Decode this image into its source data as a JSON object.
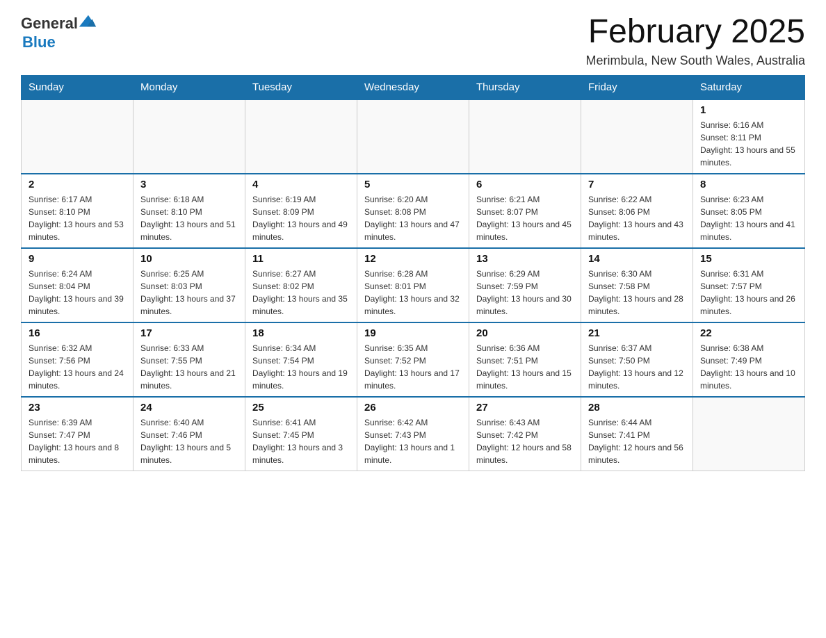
{
  "logo": {
    "general": "General",
    "blue": "Blue"
  },
  "header": {
    "title": "February 2025",
    "subtitle": "Merimbula, New South Wales, Australia"
  },
  "days_of_week": [
    "Sunday",
    "Monday",
    "Tuesday",
    "Wednesday",
    "Thursday",
    "Friday",
    "Saturday"
  ],
  "weeks": [
    [
      {
        "day": "",
        "info": ""
      },
      {
        "day": "",
        "info": ""
      },
      {
        "day": "",
        "info": ""
      },
      {
        "day": "",
        "info": ""
      },
      {
        "day": "",
        "info": ""
      },
      {
        "day": "",
        "info": ""
      },
      {
        "day": "1",
        "info": "Sunrise: 6:16 AM\nSunset: 8:11 PM\nDaylight: 13 hours and 55 minutes."
      }
    ],
    [
      {
        "day": "2",
        "info": "Sunrise: 6:17 AM\nSunset: 8:10 PM\nDaylight: 13 hours and 53 minutes."
      },
      {
        "day": "3",
        "info": "Sunrise: 6:18 AM\nSunset: 8:10 PM\nDaylight: 13 hours and 51 minutes."
      },
      {
        "day": "4",
        "info": "Sunrise: 6:19 AM\nSunset: 8:09 PM\nDaylight: 13 hours and 49 minutes."
      },
      {
        "day": "5",
        "info": "Sunrise: 6:20 AM\nSunset: 8:08 PM\nDaylight: 13 hours and 47 minutes."
      },
      {
        "day": "6",
        "info": "Sunrise: 6:21 AM\nSunset: 8:07 PM\nDaylight: 13 hours and 45 minutes."
      },
      {
        "day": "7",
        "info": "Sunrise: 6:22 AM\nSunset: 8:06 PM\nDaylight: 13 hours and 43 minutes."
      },
      {
        "day": "8",
        "info": "Sunrise: 6:23 AM\nSunset: 8:05 PM\nDaylight: 13 hours and 41 minutes."
      }
    ],
    [
      {
        "day": "9",
        "info": "Sunrise: 6:24 AM\nSunset: 8:04 PM\nDaylight: 13 hours and 39 minutes."
      },
      {
        "day": "10",
        "info": "Sunrise: 6:25 AM\nSunset: 8:03 PM\nDaylight: 13 hours and 37 minutes."
      },
      {
        "day": "11",
        "info": "Sunrise: 6:27 AM\nSunset: 8:02 PM\nDaylight: 13 hours and 35 minutes."
      },
      {
        "day": "12",
        "info": "Sunrise: 6:28 AM\nSunset: 8:01 PM\nDaylight: 13 hours and 32 minutes."
      },
      {
        "day": "13",
        "info": "Sunrise: 6:29 AM\nSunset: 7:59 PM\nDaylight: 13 hours and 30 minutes."
      },
      {
        "day": "14",
        "info": "Sunrise: 6:30 AM\nSunset: 7:58 PM\nDaylight: 13 hours and 28 minutes."
      },
      {
        "day": "15",
        "info": "Sunrise: 6:31 AM\nSunset: 7:57 PM\nDaylight: 13 hours and 26 minutes."
      }
    ],
    [
      {
        "day": "16",
        "info": "Sunrise: 6:32 AM\nSunset: 7:56 PM\nDaylight: 13 hours and 24 minutes."
      },
      {
        "day": "17",
        "info": "Sunrise: 6:33 AM\nSunset: 7:55 PM\nDaylight: 13 hours and 21 minutes."
      },
      {
        "day": "18",
        "info": "Sunrise: 6:34 AM\nSunset: 7:54 PM\nDaylight: 13 hours and 19 minutes."
      },
      {
        "day": "19",
        "info": "Sunrise: 6:35 AM\nSunset: 7:52 PM\nDaylight: 13 hours and 17 minutes."
      },
      {
        "day": "20",
        "info": "Sunrise: 6:36 AM\nSunset: 7:51 PM\nDaylight: 13 hours and 15 minutes."
      },
      {
        "day": "21",
        "info": "Sunrise: 6:37 AM\nSunset: 7:50 PM\nDaylight: 13 hours and 12 minutes."
      },
      {
        "day": "22",
        "info": "Sunrise: 6:38 AM\nSunset: 7:49 PM\nDaylight: 13 hours and 10 minutes."
      }
    ],
    [
      {
        "day": "23",
        "info": "Sunrise: 6:39 AM\nSunset: 7:47 PM\nDaylight: 13 hours and 8 minutes."
      },
      {
        "day": "24",
        "info": "Sunrise: 6:40 AM\nSunset: 7:46 PM\nDaylight: 13 hours and 5 minutes."
      },
      {
        "day": "25",
        "info": "Sunrise: 6:41 AM\nSunset: 7:45 PM\nDaylight: 13 hours and 3 minutes."
      },
      {
        "day": "26",
        "info": "Sunrise: 6:42 AM\nSunset: 7:43 PM\nDaylight: 13 hours and 1 minute."
      },
      {
        "day": "27",
        "info": "Sunrise: 6:43 AM\nSunset: 7:42 PM\nDaylight: 12 hours and 58 minutes."
      },
      {
        "day": "28",
        "info": "Sunrise: 6:44 AM\nSunset: 7:41 PM\nDaylight: 12 hours and 56 minutes."
      },
      {
        "day": "",
        "info": ""
      }
    ]
  ]
}
